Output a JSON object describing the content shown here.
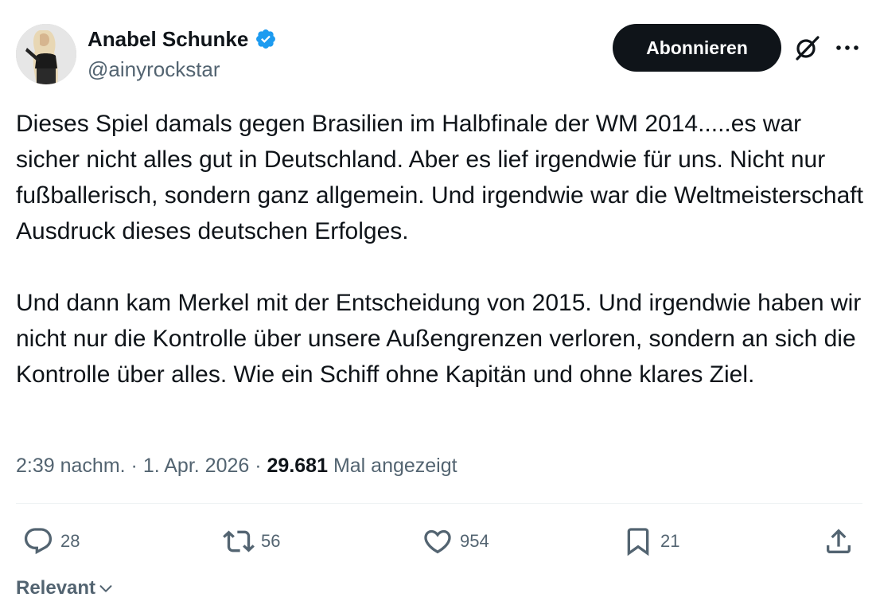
{
  "user": {
    "display_name": "Anabel Schunke",
    "handle": "@ainyrockstar",
    "verified": true
  },
  "header": {
    "subscribe_label": "Abonnieren"
  },
  "tweet": {
    "paragraphs": [
      "Dieses Spiel damals gegen Brasilien im Halbfinale der WM 2014.....es war sicher nicht alles gut in Deutschland. Aber es lief irgendwie für uns. Nicht nur fußballerisch, sondern ganz allgemein. Und irgendwie war die Weltmeisterschaft Ausdruck dieses deutschen Erfolges.",
      "Und dann kam Merkel mit der Entscheidung von 2015. Und irgendwie haben wir nicht nur die Kontrolle über unsere Außengrenzen verloren, sondern an sich die Kontrolle über alles. Wie ein Schiff ohne Kapitän und ohne klares Ziel."
    ],
    "time": "2:39 nachm.",
    "separator": "·",
    "date": "1. Apr. 2026",
    "views_count": "29.681",
    "views_label": "Mal angezeigt"
  },
  "actions": {
    "replies": "28",
    "reposts": "56",
    "likes": "954",
    "bookmarks": "21"
  },
  "sort": {
    "label": "Relevant"
  },
  "colors": {
    "text": "#0f1419",
    "secondary": "#536471",
    "verified": "#1d9bf0",
    "button_bg": "#0f1419",
    "divider": "#eff3f4"
  }
}
